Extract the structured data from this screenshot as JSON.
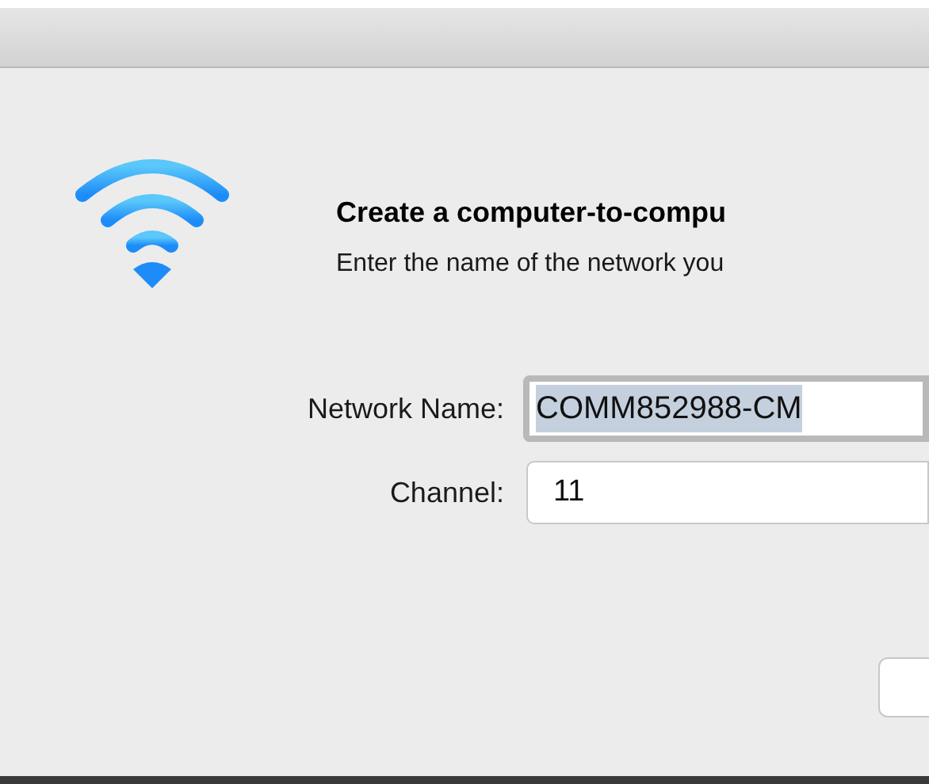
{
  "dialog": {
    "heading": "Create a computer-to-compu",
    "message": "Enter the name of the network you",
    "fields": [
      {
        "label": "Network Name:",
        "value": "COMM852988-CM",
        "focused": true
      },
      {
        "label": "Channel:",
        "value": "11",
        "focused": false
      }
    ]
  }
}
